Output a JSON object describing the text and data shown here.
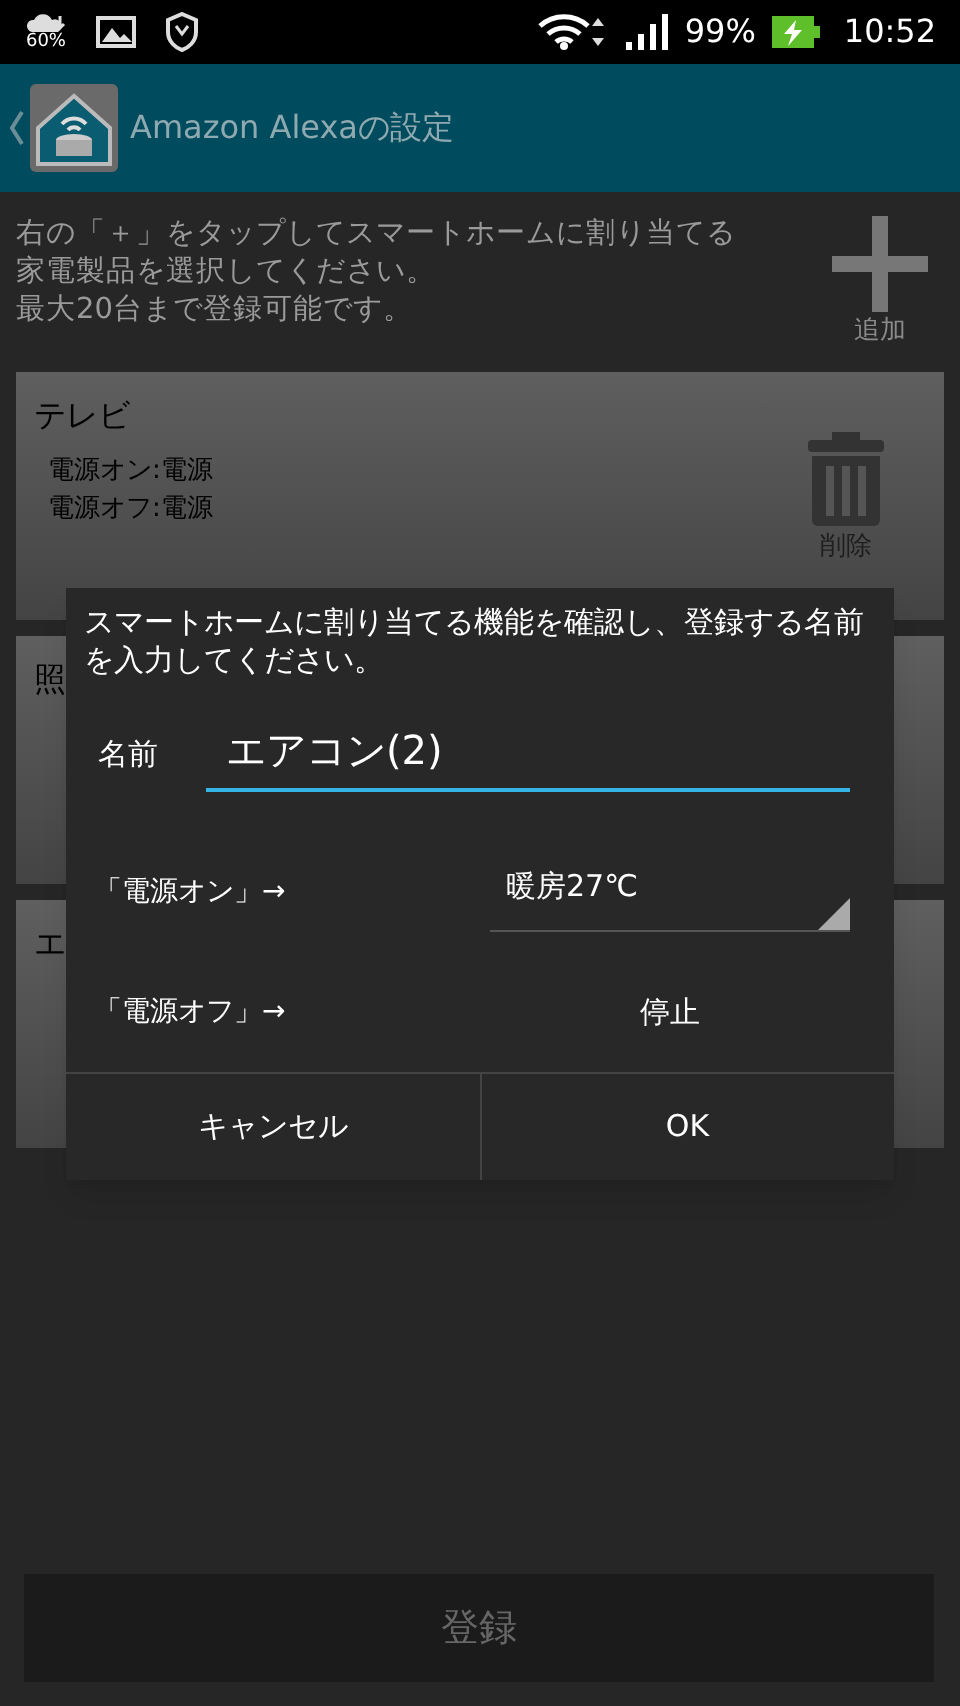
{
  "status_bar": {
    "weather": "60%",
    "battery": "99%",
    "time": "10:52"
  },
  "app_bar": {
    "title": "Amazon Alexaの設定"
  },
  "intro": {
    "lines": [
      "右の「＋」をタップしてスマートホームに割り当てる家電製品を選択してください。",
      "最大20台まで登録可能です。"
    ],
    "add_label": "追加"
  },
  "devices": [
    {
      "name": "テレビ",
      "lines": [
        "電源オン:電源",
        "電源オフ:電源"
      ],
      "delete_label": "削除"
    },
    {
      "name": "照"
    },
    {
      "name": "エ"
    }
  ],
  "dialog": {
    "message": "スマートホームに割り当てる機能を確認し、登録する名前を入力してください。",
    "name_label": "名前",
    "name_value": "エアコン(2)",
    "rows": [
      {
        "kind": "dropdown",
        "label": "「電源オン」→",
        "value": "暖房27℃"
      },
      {
        "kind": "text",
        "label": "「電源オフ」→",
        "value": "停止"
      }
    ],
    "buttons": [
      "キャンセル",
      "OK"
    ]
  },
  "register_button": {
    "label": "登録",
    "disabled": true
  }
}
